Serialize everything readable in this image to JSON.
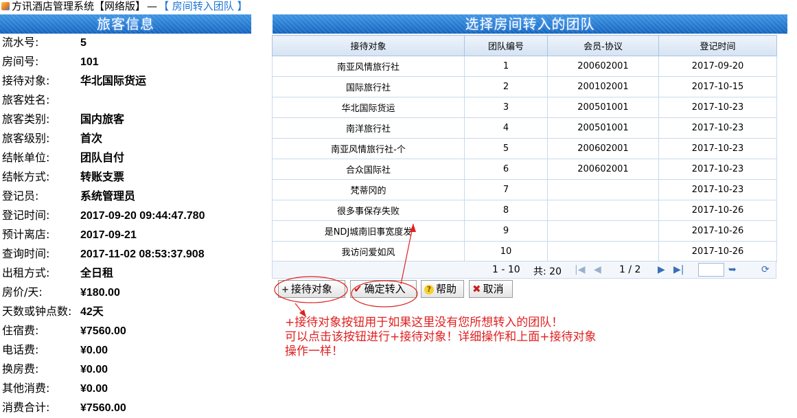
{
  "window": {
    "title": "方讯酒店管理系统【网络版】",
    "separator": "—",
    "breadcrumb": "【 房间转入团队 】"
  },
  "guest_panel": {
    "title": "旅客信息",
    "rows": [
      {
        "label": "流水号:",
        "value": "5"
      },
      {
        "label": "房间号:",
        "value": "101"
      },
      {
        "label": "接待对象:",
        "value": "华北国际货运"
      },
      {
        "label": "旅客姓名:",
        "value": ""
      },
      {
        "label": "旅客类别:",
        "value": "国内旅客"
      },
      {
        "label": "旅客级别:",
        "value": "首次"
      },
      {
        "label": "结帐单位:",
        "value": "团队自付"
      },
      {
        "label": "结帐方式:",
        "value": "转账支票"
      },
      {
        "label": "登记员:",
        "value": "系统管理员"
      },
      {
        "label": "登记时间:",
        "value": "2017-09-20 09:44:47.780"
      },
      {
        "label": "预计离店:",
        "value": "2017-09-21"
      },
      {
        "label": "查询时间:",
        "value": "2017-11-02 08:53:37.908"
      },
      {
        "label": "出租方式:",
        "value": "全日租"
      },
      {
        "label": "房价/天:",
        "value": "¥180.00"
      },
      {
        "label": "天数或钟点数:",
        "value": "42天"
      },
      {
        "label": "住宿费:",
        "value": "¥7560.00"
      },
      {
        "label": "电话费:",
        "value": "¥0.00"
      },
      {
        "label": "换房费:",
        "value": "¥0.00"
      },
      {
        "label": "其他消费:",
        "value": "¥0.00"
      },
      {
        "label": "消费合计:",
        "value": "¥7560.00"
      }
    ]
  },
  "team_panel": {
    "title": "选择房间转入的团队",
    "columns": [
      "接待对象",
      "团队编号",
      "会员-协议",
      "登记时间"
    ],
    "rows": [
      [
        "南亚风情旅行社",
        "1",
        "200602001",
        "2017-09-20"
      ],
      [
        "国际旅行社",
        "2",
        "200102001",
        "2017-10-15"
      ],
      [
        "华北国际货运",
        "3",
        "200501001",
        "2017-10-23"
      ],
      [
        "南洋旅行社",
        "4",
        "200501001",
        "2017-10-23"
      ],
      [
        "南亚风情旅行社-个",
        "5",
        "200602001",
        "2017-10-23"
      ],
      [
        "合众国际社",
        "6",
        "200602001",
        "2017-10-23"
      ],
      [
        "梵蒂冈的",
        "7",
        "",
        "2017-10-23"
      ],
      [
        "很多事保存失败",
        "8",
        "",
        "2017-10-26"
      ],
      [
        "是NDJ城南旧事宽度发",
        "9",
        "",
        "2017-10-26"
      ],
      [
        "我访问爱如风",
        "10",
        "",
        "2017-10-26"
      ]
    ],
    "pager": {
      "range": "1 - 10",
      "total": "共: 20",
      "page": "1 / 2",
      "first_icon": "first-page-icon",
      "prev_icon": "prev-page-icon",
      "next_icon": "next-page-icon",
      "last_icon": "last-page-icon",
      "go_icon": "go-arrow-icon",
      "refresh_icon": "refresh-icon"
    }
  },
  "buttons": {
    "add_label": "接待对象",
    "confirm_label": "确定转入",
    "help_label": "帮助",
    "cancel_label": "取消"
  },
  "annotation": {
    "lines": [
      "+接待对象按钮用于如果这里没有您所想转入的团队！",
      "可以点击该按钮进行+接待对象！详细操作和上面+接待对象",
      "操作一样！"
    ],
    "color": "#e02020"
  },
  "colors": {
    "header_blue": "#1565c0",
    "link_blue": "#1d74d8",
    "grid_header_bg": "#dfe9f6"
  }
}
